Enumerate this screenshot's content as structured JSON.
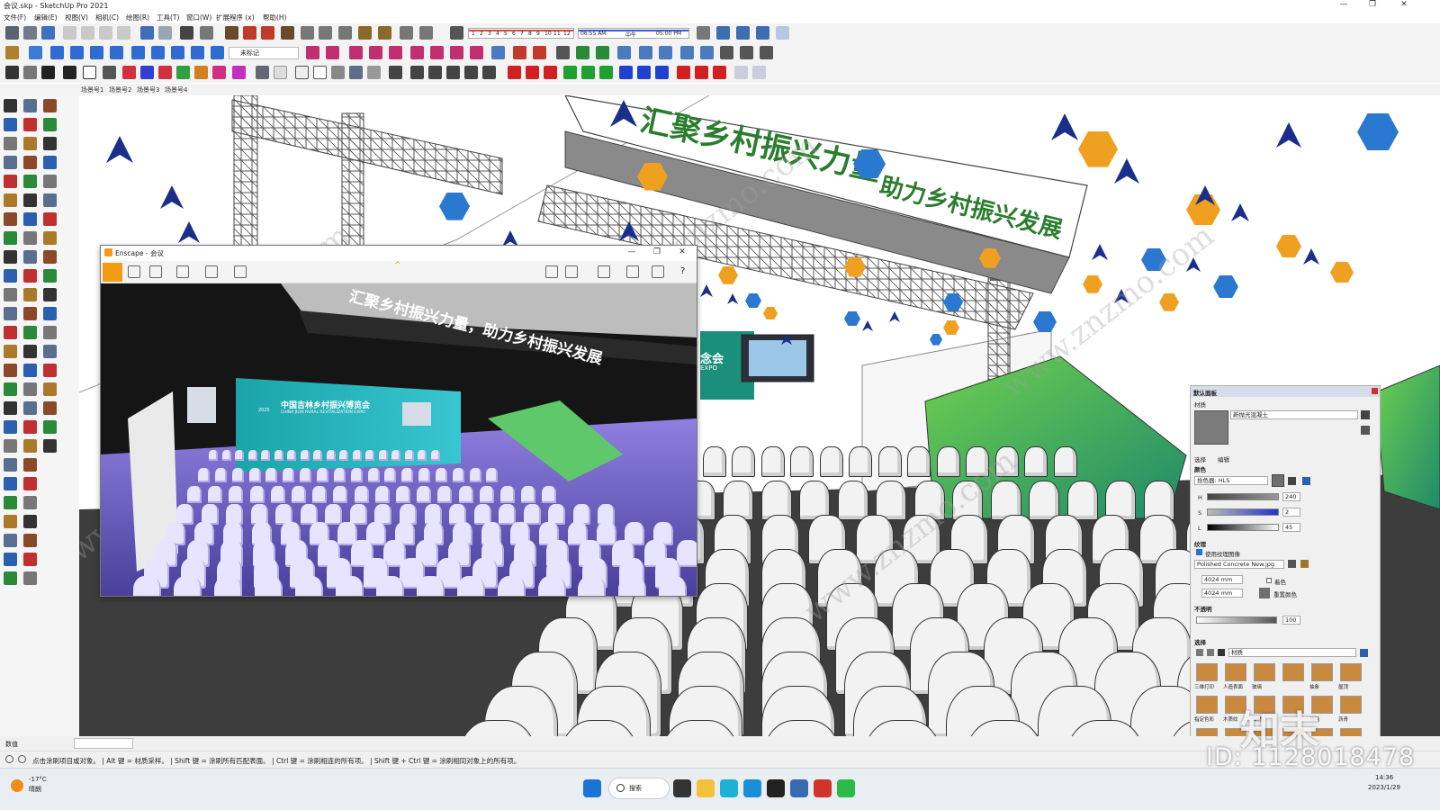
{
  "window": {
    "title": "会议.skp - SketchUp Pro 2021",
    "controls": [
      "—",
      "❐",
      "✕"
    ]
  },
  "menu": [
    "文件(F)",
    "编辑(E)",
    "视图(V)",
    "相机(C)",
    "绘图(R)",
    "工具(T)",
    "窗口(W)",
    "扩展程序 (x)",
    "帮助(H)"
  ],
  "shadow_bar": {
    "months": [
      "1",
      "2",
      "3",
      "4",
      "5",
      "6",
      "7",
      "8",
      "9",
      "10",
      "11",
      "12"
    ],
    "time_start": "06:55 AM",
    "noon": "中午",
    "time_end": "05:00 PM"
  },
  "tag_select": "未标记",
  "scenes": [
    "场景号1",
    "场景号2",
    "场景号3",
    "场景号4"
  ],
  "viewport": {
    "banner_text_1": "汇聚乡村振兴力量",
    "banner_text_2": "助力乡村振兴发展",
    "screen_text_1": "念会",
    "screen_text_2": "EXPO"
  },
  "watermark": "www.znzmo.com",
  "enscape": {
    "title": "Enscape - 会议",
    "controls": [
      "—",
      "❐",
      "✕"
    ],
    "render_banner": "汇聚乡村振兴力量，助力乡村振兴发展",
    "render_screen_title": "中国吉林乡村振兴博览会",
    "render_screen_sub": "CHINA JILIN RURAL REVITALIZATION EXPO",
    "render_screen_year": "2025"
  },
  "tray": {
    "header": "默认面板",
    "section": "材质",
    "material_name": "新抛光混凝土",
    "tabs": [
      "选择",
      "编辑"
    ],
    "color_label": "颜色",
    "picker_label": "拾色器: HLS",
    "h_label": "H",
    "h_value": "240",
    "s_label": "S",
    "s_value": "2",
    "l_label": "L",
    "l_value": "45",
    "texture_label": "纹理",
    "use_texture": "使用纹理图像",
    "texture_file": "Polished Concrete New.jpg",
    "width_value": "4024 mm",
    "height_value": "4024 mm",
    "colorize": "着色",
    "reset_color": "重置颜色",
    "opacity_label": "不透明",
    "opacity_value": "100",
    "select_label": "选择",
    "library": "材质",
    "swatch_labels": [
      "三维打印",
      "人造表面",
      "玻璃",
      "",
      "抽象",
      "屋顶",
      "指定色彩",
      "木质纹",
      "石材",
      "",
      "地毯",
      "沥青",
      "瓦片",
      "砖",
      "覆层",
      "窗帘",
      "金属",
      "颜色"
    ]
  },
  "vcb_label": "数值",
  "status_text": "点击涂刷项目或对象。 | Alt 键 = 材质采样。 | Shift 键 = 涂刷所有匹配表面。 | Ctrl 键 = 涂刷相连的所有项。 | Shift 键 + Ctrl 键 = 涂刷相同对象上的所有项。",
  "taskbar": {
    "weather_temp": "-17°C",
    "weather_desc": "晴朗",
    "search": "搜索",
    "time": "14:36",
    "date": "2023/1/29"
  },
  "stamp_id": "ID: 1128018478",
  "stamp_logo": "知末",
  "colors": {
    "banner_green": "#2b7d2e",
    "hex_orange": "#f0a020",
    "hex_blue": "#2a78d0",
    "arrow_navy": "#1a2f8a",
    "selection_blue": "#1f55d8",
    "sat_bar": "#2233cc"
  },
  "icons": [
    "home-icon",
    "search-icon",
    "select-arrow-icon",
    "paint-bucket-icon",
    "eraser-icon",
    "orbit-icon",
    "pan-icon",
    "zoom-icon"
  ]
}
